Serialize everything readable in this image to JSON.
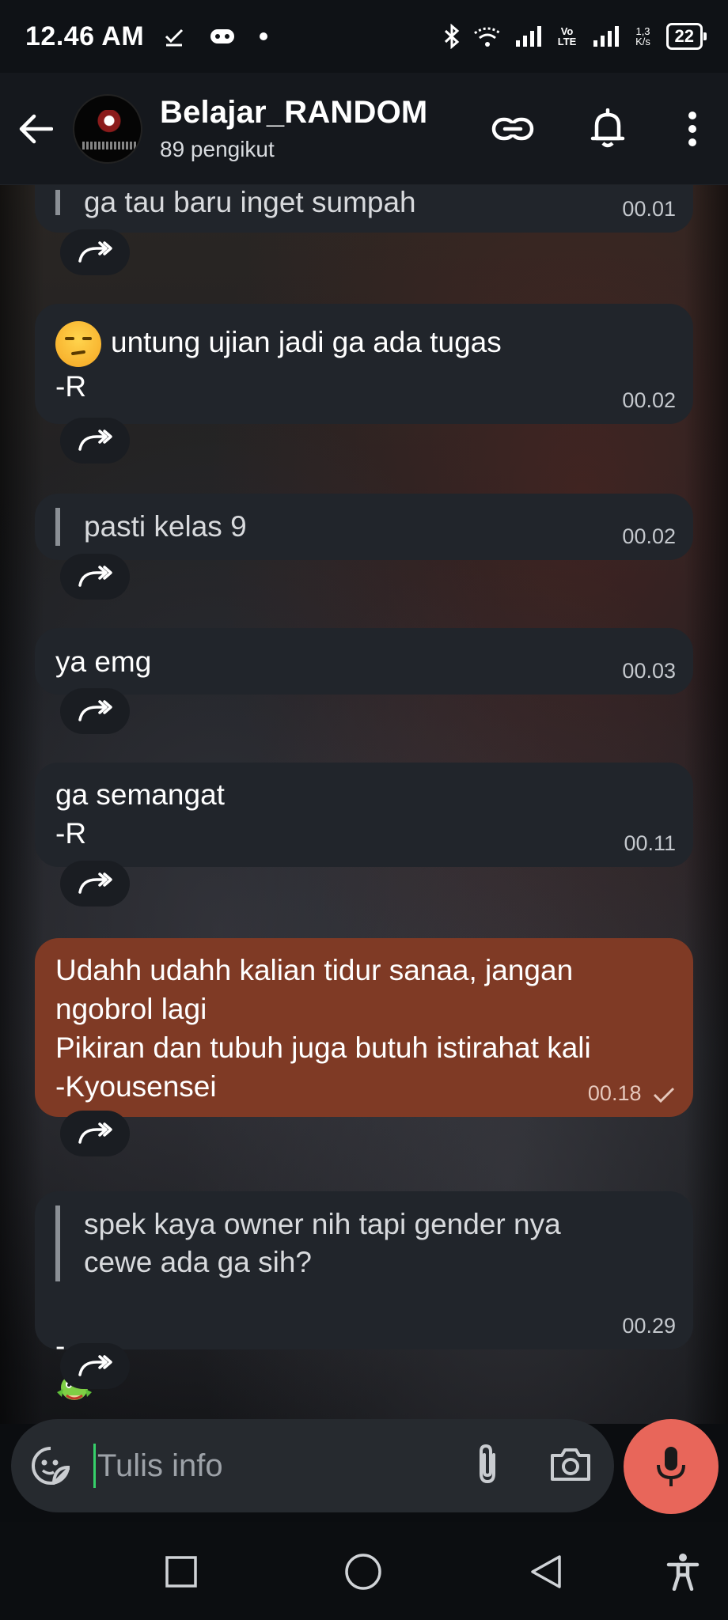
{
  "status_bar": {
    "time": "12.46 AM",
    "network_label": "Vo LTE",
    "speed": "1,3 K/s",
    "battery": "22"
  },
  "header": {
    "title": "Belajar_RANDOM",
    "subtitle": "89 pengikut"
  },
  "messages": [
    {
      "type": "quote",
      "text": "ga tau baru inget sumpah",
      "time": "00.01"
    },
    {
      "type": "plain",
      "emoji": "unamused-face",
      "text": "untung ujian jadi ga ada tugas\n-R",
      "time": "00.02"
    },
    {
      "type": "quote",
      "text": "pasti kelas 9",
      "time": "00.02"
    },
    {
      "type": "plain",
      "text": "ya emg",
      "time": "00.03"
    },
    {
      "type": "plain",
      "text": "ga semangat\n-R",
      "time": "00.11"
    },
    {
      "type": "plain",
      "text": "Udahh udahh kalian tidur sanaa, jangan ngobrol lagi\nPikiran dan tubuh juga butuh istirahat kali\n-Kyousensei",
      "time": "00.18",
      "accent": "#7f3a25",
      "status": "sent"
    },
    {
      "type": "quote",
      "text": "spek kaya owner nih tapi gender nya cewe ada ga sih?",
      "sign": "-",
      "emoji": "dragon",
      "time": "00.29"
    }
  ],
  "composer": {
    "placeholder": "Tulis info"
  },
  "colors": {
    "bubble": "#21252b",
    "own_bubble": "#7f3a25",
    "mic": "#e8665a",
    "cursor": "#36d06a"
  }
}
